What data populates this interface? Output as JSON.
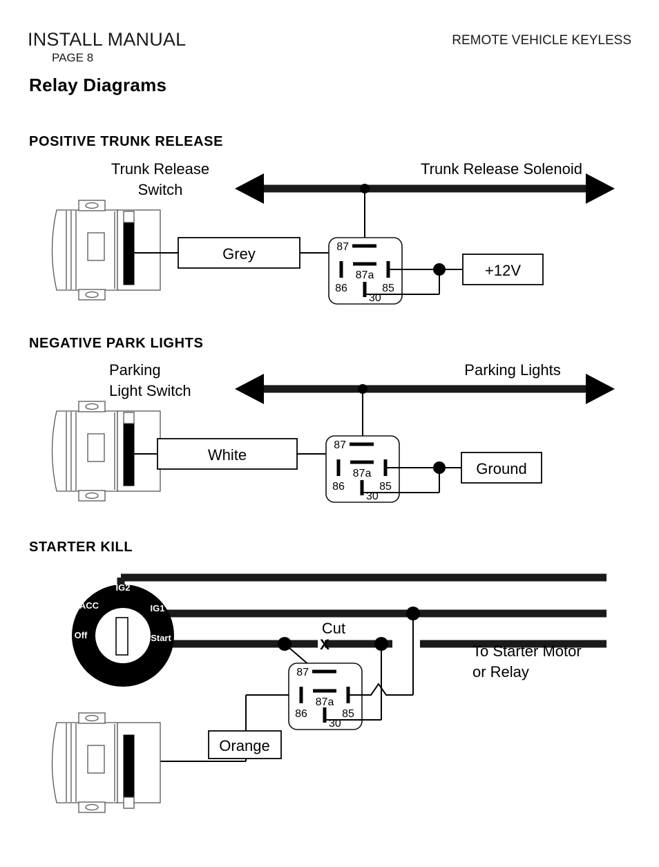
{
  "header": {
    "manual_title": "INSTALL MANUAL",
    "page_number": "PAGE 8",
    "product_name": "REMOTE VEHICLE KEYLESS",
    "page_title": "Relay Diagrams"
  },
  "relay_pins": {
    "pin_87": "87",
    "pin_87a": "87a",
    "pin_86": "86",
    "pin_85": "85",
    "pin_30": "30"
  },
  "sections": [
    {
      "id": "positive-trunk-release",
      "heading": "POSITIVE TRUNK RELEASE",
      "switch_label_line1": "Trunk Release",
      "switch_label_line2": "Switch",
      "bus_label": "Trunk Release Solenoid",
      "wire_color_label": "Grey",
      "supply_label": "+12V"
    },
    {
      "id": "negative-park-lights",
      "heading": "NEGATIVE PARK LIGHTS",
      "switch_label_line1": "Parking",
      "switch_label_line2": "Light Switch",
      "bus_label": "Parking Lights",
      "wire_color_label": "White",
      "supply_label": "Ground"
    },
    {
      "id": "starter-kill",
      "heading": "STARTER KILL",
      "wire_color_label": "Orange",
      "cut_label": "Cut",
      "cut_marker": "X",
      "destination_line1": "To Starter Motor",
      "destination_line2": "or Relay",
      "ignition_positions": [
        "IG2",
        "ACC",
        "Off",
        "IG1",
        "Start"
      ]
    }
  ],
  "colors": {
    "ink": "#000000",
    "paper": "#ffffff",
    "bus": "#1a1a1a",
    "device_outline": "#555555"
  }
}
